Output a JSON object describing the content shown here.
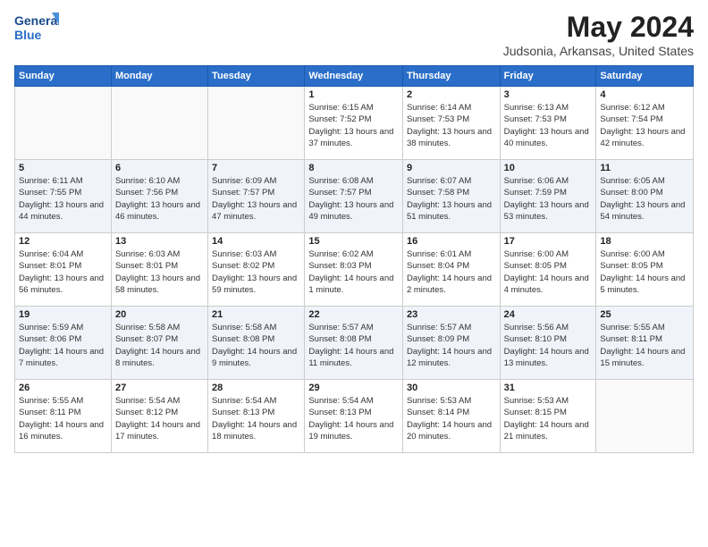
{
  "header": {
    "logo_line1": "General",
    "logo_line2": "Blue",
    "title": "May 2024",
    "subtitle": "Judsonia, Arkansas, United States"
  },
  "days_of_week": [
    "Sunday",
    "Monday",
    "Tuesday",
    "Wednesday",
    "Thursday",
    "Friday",
    "Saturday"
  ],
  "weeks": [
    [
      {
        "day": "",
        "info": ""
      },
      {
        "day": "",
        "info": ""
      },
      {
        "day": "",
        "info": ""
      },
      {
        "day": "1",
        "info": "Sunrise: 6:15 AM\nSunset: 7:52 PM\nDaylight: 13 hours and 37 minutes."
      },
      {
        "day": "2",
        "info": "Sunrise: 6:14 AM\nSunset: 7:53 PM\nDaylight: 13 hours and 38 minutes."
      },
      {
        "day": "3",
        "info": "Sunrise: 6:13 AM\nSunset: 7:53 PM\nDaylight: 13 hours and 40 minutes."
      },
      {
        "day": "4",
        "info": "Sunrise: 6:12 AM\nSunset: 7:54 PM\nDaylight: 13 hours and 42 minutes."
      }
    ],
    [
      {
        "day": "5",
        "info": "Sunrise: 6:11 AM\nSunset: 7:55 PM\nDaylight: 13 hours and 44 minutes."
      },
      {
        "day": "6",
        "info": "Sunrise: 6:10 AM\nSunset: 7:56 PM\nDaylight: 13 hours and 46 minutes."
      },
      {
        "day": "7",
        "info": "Sunrise: 6:09 AM\nSunset: 7:57 PM\nDaylight: 13 hours and 47 minutes."
      },
      {
        "day": "8",
        "info": "Sunrise: 6:08 AM\nSunset: 7:57 PM\nDaylight: 13 hours and 49 minutes."
      },
      {
        "day": "9",
        "info": "Sunrise: 6:07 AM\nSunset: 7:58 PM\nDaylight: 13 hours and 51 minutes."
      },
      {
        "day": "10",
        "info": "Sunrise: 6:06 AM\nSunset: 7:59 PM\nDaylight: 13 hours and 53 minutes."
      },
      {
        "day": "11",
        "info": "Sunrise: 6:05 AM\nSunset: 8:00 PM\nDaylight: 13 hours and 54 minutes."
      }
    ],
    [
      {
        "day": "12",
        "info": "Sunrise: 6:04 AM\nSunset: 8:01 PM\nDaylight: 13 hours and 56 minutes."
      },
      {
        "day": "13",
        "info": "Sunrise: 6:03 AM\nSunset: 8:01 PM\nDaylight: 13 hours and 58 minutes."
      },
      {
        "day": "14",
        "info": "Sunrise: 6:03 AM\nSunset: 8:02 PM\nDaylight: 13 hours and 59 minutes."
      },
      {
        "day": "15",
        "info": "Sunrise: 6:02 AM\nSunset: 8:03 PM\nDaylight: 14 hours and 1 minute."
      },
      {
        "day": "16",
        "info": "Sunrise: 6:01 AM\nSunset: 8:04 PM\nDaylight: 14 hours and 2 minutes."
      },
      {
        "day": "17",
        "info": "Sunrise: 6:00 AM\nSunset: 8:05 PM\nDaylight: 14 hours and 4 minutes."
      },
      {
        "day": "18",
        "info": "Sunrise: 6:00 AM\nSunset: 8:05 PM\nDaylight: 14 hours and 5 minutes."
      }
    ],
    [
      {
        "day": "19",
        "info": "Sunrise: 5:59 AM\nSunset: 8:06 PM\nDaylight: 14 hours and 7 minutes."
      },
      {
        "day": "20",
        "info": "Sunrise: 5:58 AM\nSunset: 8:07 PM\nDaylight: 14 hours and 8 minutes."
      },
      {
        "day": "21",
        "info": "Sunrise: 5:58 AM\nSunset: 8:08 PM\nDaylight: 14 hours and 9 minutes."
      },
      {
        "day": "22",
        "info": "Sunrise: 5:57 AM\nSunset: 8:08 PM\nDaylight: 14 hours and 11 minutes."
      },
      {
        "day": "23",
        "info": "Sunrise: 5:57 AM\nSunset: 8:09 PM\nDaylight: 14 hours and 12 minutes."
      },
      {
        "day": "24",
        "info": "Sunrise: 5:56 AM\nSunset: 8:10 PM\nDaylight: 14 hours and 13 minutes."
      },
      {
        "day": "25",
        "info": "Sunrise: 5:55 AM\nSunset: 8:11 PM\nDaylight: 14 hours and 15 minutes."
      }
    ],
    [
      {
        "day": "26",
        "info": "Sunrise: 5:55 AM\nSunset: 8:11 PM\nDaylight: 14 hours and 16 minutes."
      },
      {
        "day": "27",
        "info": "Sunrise: 5:54 AM\nSunset: 8:12 PM\nDaylight: 14 hours and 17 minutes."
      },
      {
        "day": "28",
        "info": "Sunrise: 5:54 AM\nSunset: 8:13 PM\nDaylight: 14 hours and 18 minutes."
      },
      {
        "day": "29",
        "info": "Sunrise: 5:54 AM\nSunset: 8:13 PM\nDaylight: 14 hours and 19 minutes."
      },
      {
        "day": "30",
        "info": "Sunrise: 5:53 AM\nSunset: 8:14 PM\nDaylight: 14 hours and 20 minutes."
      },
      {
        "day": "31",
        "info": "Sunrise: 5:53 AM\nSunset: 8:15 PM\nDaylight: 14 hours and 21 minutes."
      },
      {
        "day": "",
        "info": ""
      }
    ]
  ]
}
